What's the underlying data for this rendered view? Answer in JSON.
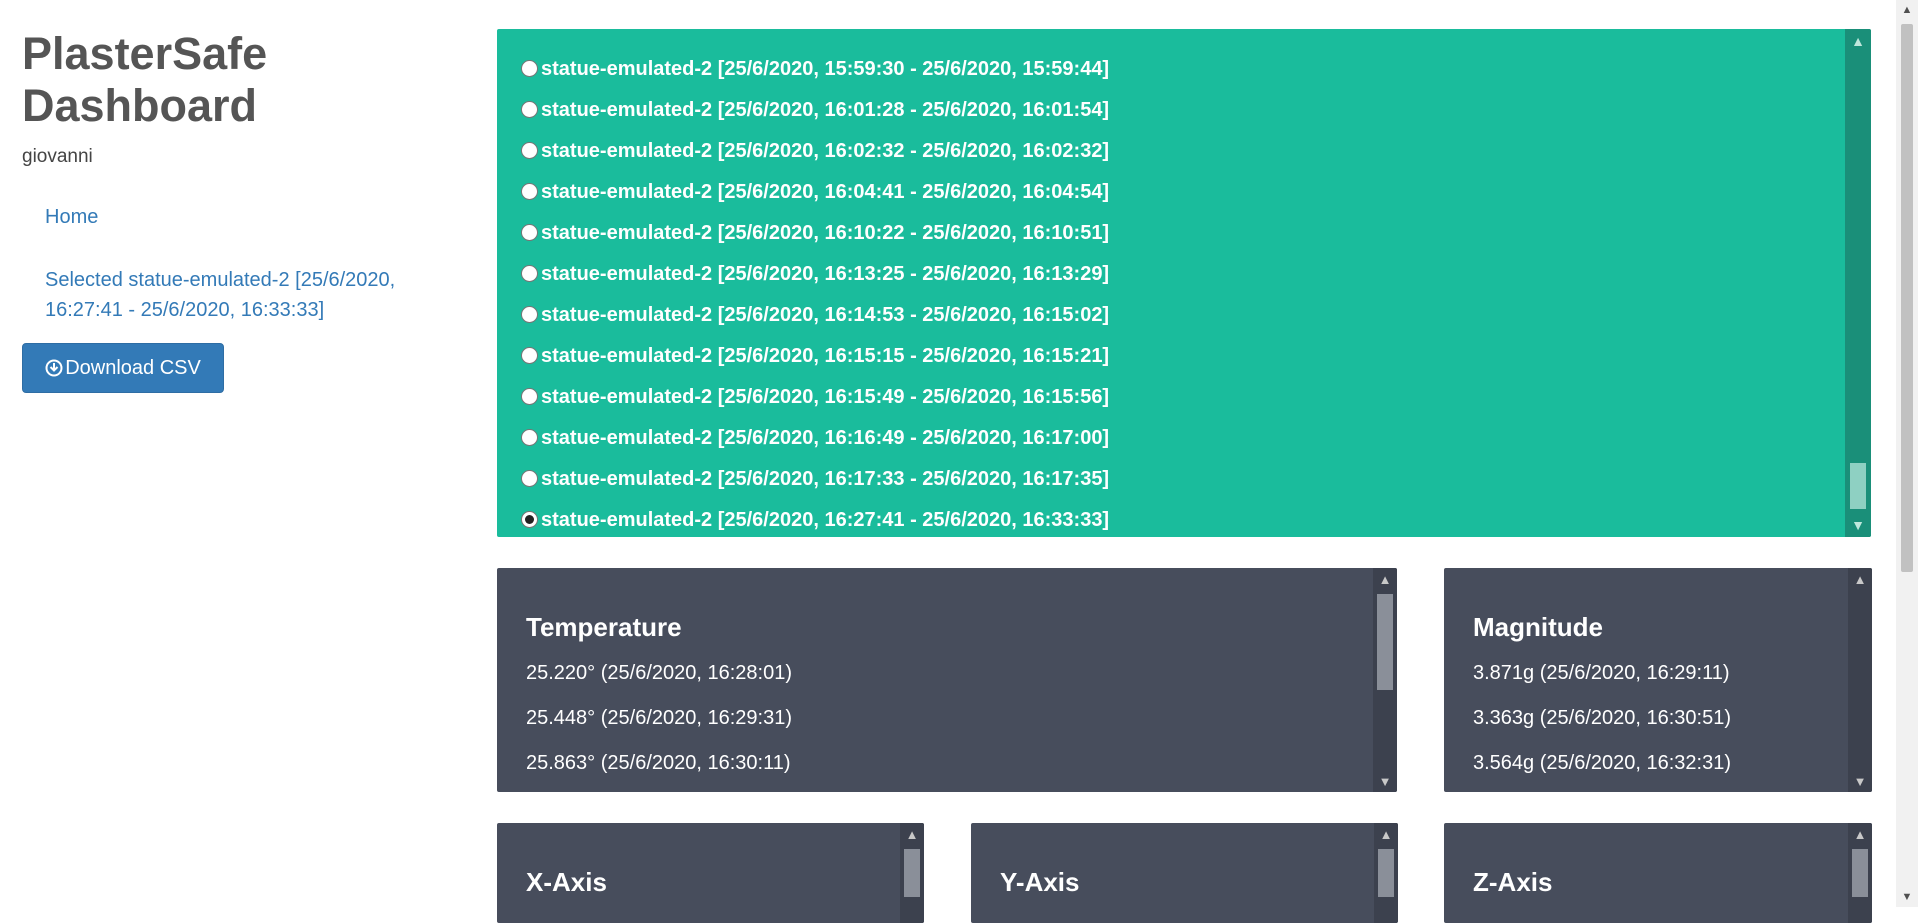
{
  "app": {
    "title": "PlasterSafe Dashboard",
    "user": "giovanni"
  },
  "nav": {
    "home": "Home",
    "selected": "Selected statue-emulated-2 [25/6/2020, 16:27:41 - 25/6/2020, 16:33:33]",
    "download_label": "Download CSV"
  },
  "sessions": [
    {
      "label": "statue-emulated-2 [25/6/2020, 15:59:30 - 25/6/2020, 15:59:44]",
      "selected": false
    },
    {
      "label": "statue-emulated-2 [25/6/2020, 16:01:28 - 25/6/2020, 16:01:54]",
      "selected": false
    },
    {
      "label": "statue-emulated-2 [25/6/2020, 16:02:32 - 25/6/2020, 16:02:32]",
      "selected": false
    },
    {
      "label": "statue-emulated-2 [25/6/2020, 16:04:41 - 25/6/2020, 16:04:54]",
      "selected": false
    },
    {
      "label": "statue-emulated-2 [25/6/2020, 16:10:22 - 25/6/2020, 16:10:51]",
      "selected": false
    },
    {
      "label": "statue-emulated-2 [25/6/2020, 16:13:25 - 25/6/2020, 16:13:29]",
      "selected": false
    },
    {
      "label": "statue-emulated-2 [25/6/2020, 16:14:53 - 25/6/2020, 16:15:02]",
      "selected": false
    },
    {
      "label": "statue-emulated-2 [25/6/2020, 16:15:15 - 25/6/2020, 16:15:21]",
      "selected": false
    },
    {
      "label": "statue-emulated-2 [25/6/2020, 16:15:49 - 25/6/2020, 16:15:56]",
      "selected": false
    },
    {
      "label": "statue-emulated-2 [25/6/2020, 16:16:49 - 25/6/2020, 16:17:00]",
      "selected": false
    },
    {
      "label": "statue-emulated-2 [25/6/2020, 16:17:33 - 25/6/2020, 16:17:35]",
      "selected": false
    },
    {
      "label": "statue-emulated-2 [25/6/2020, 16:27:41 - 25/6/2020, 16:33:33]",
      "selected": true
    }
  ],
  "cards": {
    "temperature": {
      "title": "Temperature",
      "readings": [
        "25.220° (25/6/2020, 16:28:01)",
        "25.448° (25/6/2020, 16:29:31)",
        "25.863° (25/6/2020, 16:30:11)"
      ]
    },
    "magnitude": {
      "title": "Magnitude",
      "readings": [
        "3.871g (25/6/2020, 16:29:11)",
        "3.363g (25/6/2020, 16:30:51)",
        "3.564g (25/6/2020, 16:32:31)"
      ]
    },
    "x_axis": {
      "title": "X-Axis"
    },
    "y_axis": {
      "title": "Y-Axis"
    },
    "z_axis": {
      "title": "Z-Axis"
    }
  },
  "icons": {
    "download": "download-circle-icon"
  },
  "colors": {
    "accent": "#1abc9c",
    "card_bg": "#474d5c",
    "link": "#337ab7",
    "button": "#337ab7"
  }
}
